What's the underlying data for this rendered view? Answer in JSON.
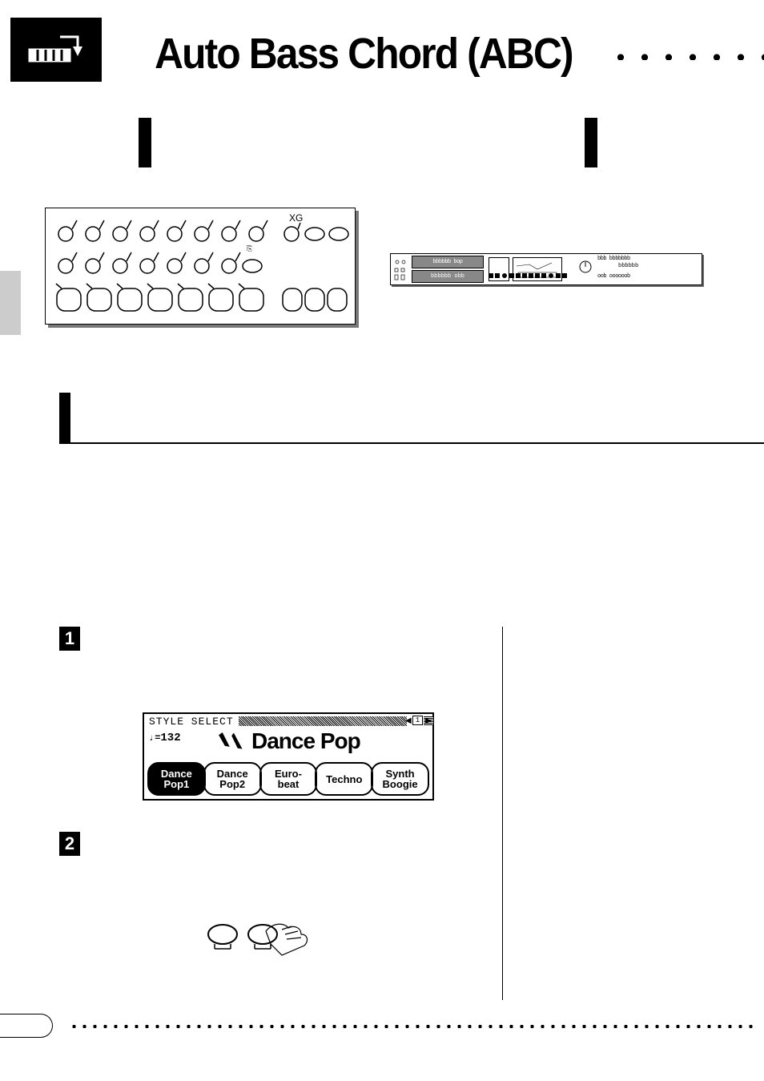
{
  "heading": {
    "title": "Auto Bass Chord (ABC)",
    "dots": "",
    "intro_heavy_bar_left": "",
    "intro_heavy_bar_right": ""
  },
  "section_bar": {
    "title": ""
  },
  "lcd": {
    "header": "STYLE SELECT",
    "bpm": "132",
    "style_name": "Dance Pop",
    "tabs": [
      "Dance\nPop1",
      "Dance\nPop2",
      "Euro-\nbeat",
      "Techno",
      "Synth\nBoogie"
    ],
    "decor_left": "✎",
    "decor_right": "⬣",
    "header_icon": "1"
  },
  "steps": {
    "one": {
      "num": "1"
    },
    "two": {
      "num": "2"
    }
  },
  "mini_panel": {
    "zone1_top": "bbbbbb bop",
    "zone1_bot": "bbbbbb",
    "zone2_top": "bbbbbb obb",
    "right1_top": "bbb bbbbbbb",
    "right1_bot": "bbbbbb",
    "right2_top": "oob oooooob"
  }
}
